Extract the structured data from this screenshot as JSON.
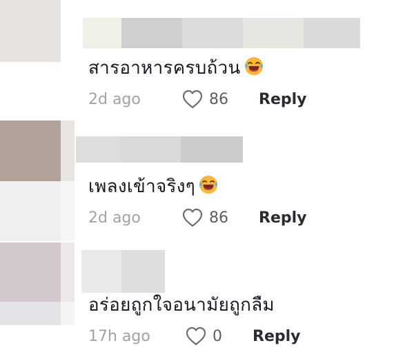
{
  "comments": [
    {
      "text": "สารอาหารครบถ้วน",
      "emoji": "laughing-tears-emoji",
      "time": "2d ago",
      "likes": "86",
      "reply_label": "Reply"
    },
    {
      "text": "เพลงเข้าจริงๆ",
      "emoji": "laughing-tears-emoji",
      "time": "2d ago",
      "likes": "86",
      "reply_label": "Reply"
    },
    {
      "text": "อร่อยถูกใจอนามัยถูกลืม",
      "emoji": "",
      "time": "17h ago",
      "likes": "0",
      "reply_label": "Reply"
    }
  ],
  "colors": {
    "text": "#161823",
    "muted": "#a0a2a7",
    "reply": "#2b2c33",
    "emoji_face": "#ffb636"
  }
}
